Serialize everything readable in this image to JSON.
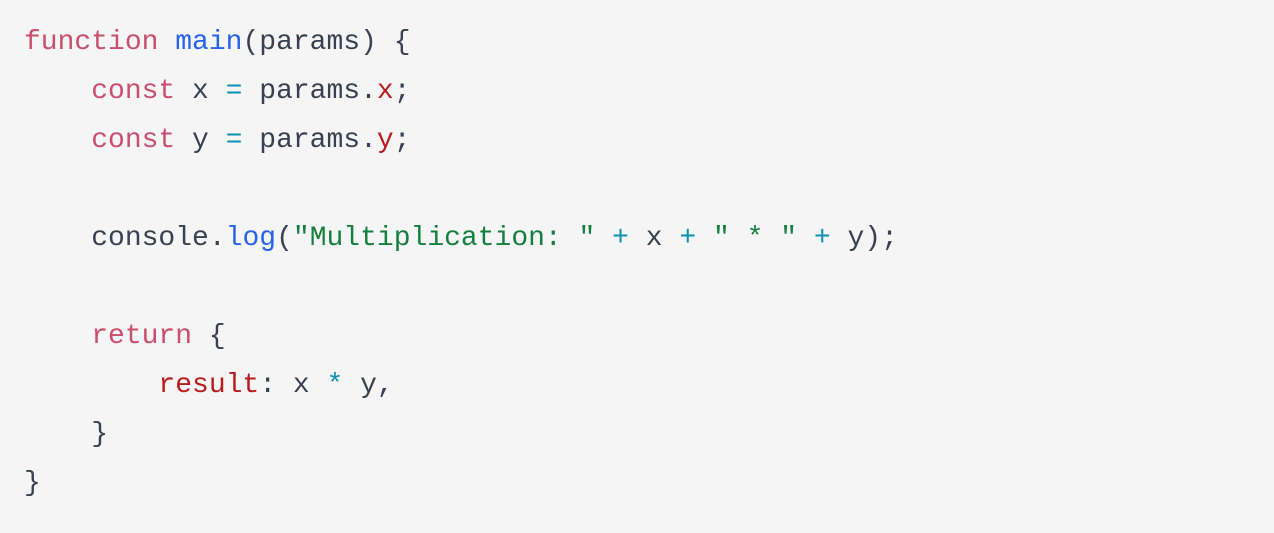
{
  "code": {
    "line1": {
      "kw_function": "function",
      "fn_name": "main",
      "paren_open": "(",
      "param": "params",
      "paren_close": ")",
      "brace_open": " {"
    },
    "line2": {
      "indent": "    ",
      "kw_const": "const",
      "var": " x ",
      "eq": "=",
      "obj": " params",
      "dot": ".",
      "prop": "x",
      "semi": ";"
    },
    "line3": {
      "indent": "    ",
      "kw_const": "const",
      "var": " y ",
      "eq": "=",
      "obj": " params",
      "dot": ".",
      "prop": "y",
      "semi": ";"
    },
    "line5": {
      "indent": "    ",
      "obj": "console",
      "dot": ".",
      "fn": "log",
      "paren_open": "(",
      "str1": "\"Multiplication: \"",
      "plus1": " + ",
      "x": "x",
      "plus2": " + ",
      "str2": "\" * \"",
      "plus3": " + ",
      "y": "y",
      "paren_close": ")",
      "semi": ";"
    },
    "line7": {
      "indent": "    ",
      "kw_return": "return",
      "brace_open": " {"
    },
    "line8": {
      "indent": "        ",
      "prop": "result",
      "colon": ":",
      "x": " x ",
      "star": "*",
      "y": " y",
      "comma": ","
    },
    "line9": {
      "indent": "    ",
      "brace_close": "}"
    },
    "line10": {
      "brace_close": "}"
    }
  }
}
